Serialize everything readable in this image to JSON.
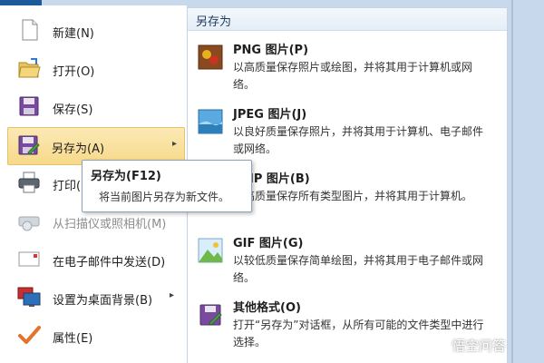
{
  "left_menu": {
    "items": [
      {
        "label": "新建(N)",
        "icon": "new-document-icon",
        "disabled": false
      },
      {
        "label": "打开(O)",
        "icon": "open-folder-icon",
        "disabled": false
      },
      {
        "label": "保存(S)",
        "icon": "save-disk-icon",
        "disabled": false
      },
      {
        "label": "另存为(A)",
        "icon": "save-as-icon",
        "disabled": false,
        "highlighted": true,
        "has_submenu": true
      },
      {
        "label": "打印(P)",
        "icon": "printer-icon",
        "disabled": false,
        "has_submenu": true
      },
      {
        "label": "从扫描仪或照相机(M)",
        "icon": "scanner-icon",
        "disabled": true
      },
      {
        "label": "在电子邮件中发送(D)",
        "icon": "email-icon",
        "disabled": false
      },
      {
        "label": "设置为桌面背景(B)",
        "icon": "desktop-background-icon",
        "disabled": false,
        "has_submenu": true
      },
      {
        "label": "属性(E)",
        "icon": "properties-check-icon",
        "disabled": false
      }
    ]
  },
  "submenu": {
    "title": "另存为",
    "items": [
      {
        "title": "PNG 图片(P)",
        "desc": "以高质量保存照片或绘图，并将其用于计算机或网络。",
        "icon": "png-image-icon"
      },
      {
        "title": "JPEG 图片(J)",
        "desc": "以良好质量保存照片，并将其用于计算机、电子邮件或网络。",
        "icon": "jpeg-image-icon"
      },
      {
        "title": "BMP 图片(B)",
        "desc": "以高质量保存所有类型图片，并将其用于计算机。",
        "icon": "bmp-image-icon"
      },
      {
        "title": "GIF 图片(G)",
        "desc": "以较低质量保存简单绘图，并将其用于电子邮件或网络。",
        "icon": "gif-image-icon"
      },
      {
        "title": "其他格式(O)",
        "desc": "打开“另存为”对话框，从所有可能的文件类型中进行选择。",
        "icon": "other-formats-icon"
      }
    ]
  },
  "tooltip": {
    "title": "另存为(F12)",
    "description": "将当前图片另存为新文件。"
  },
  "watermark": {
    "text": "悟空问答"
  },
  "colors": {
    "highlight": "#f7d98a",
    "header_text": "#1e395b",
    "disabled_text": "#8d8d8d",
    "frame": "#c8d8ec"
  }
}
